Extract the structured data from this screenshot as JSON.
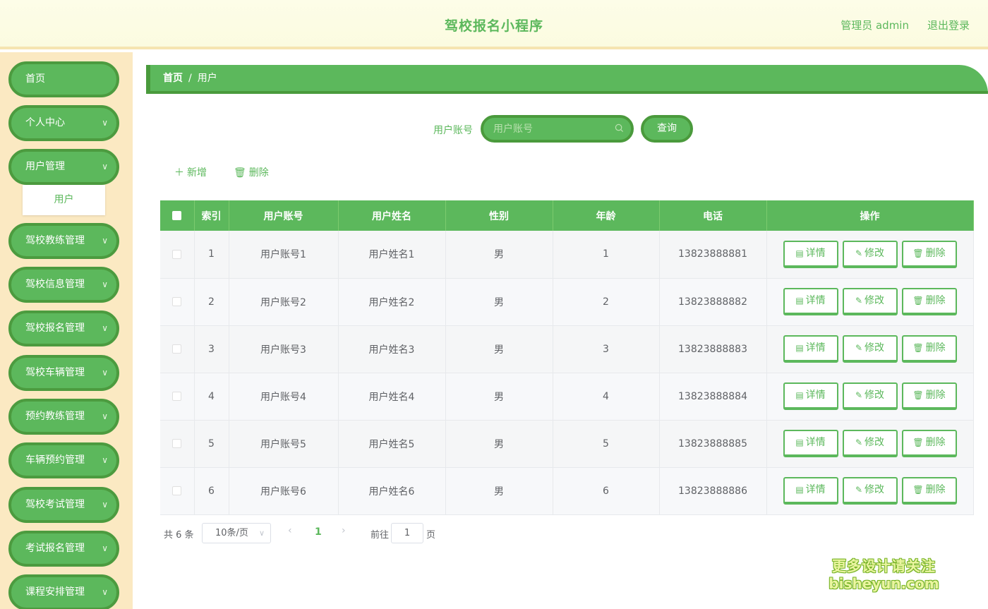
{
  "header": {
    "title": "驾校报名小程序",
    "user": "管理员 admin",
    "logout": "退出登录"
  },
  "sidebar": {
    "items": [
      {
        "label": "首页",
        "has_children": false
      },
      {
        "label": "个人中心",
        "has_children": true
      },
      {
        "label": "用户管理",
        "has_children": true,
        "expanded": true,
        "children": [
          {
            "label": "用户"
          }
        ]
      },
      {
        "label": "驾校教练管理",
        "has_children": true
      },
      {
        "label": "驾校信息管理",
        "has_children": true
      },
      {
        "label": "驾校报名管理",
        "has_children": true
      },
      {
        "label": "驾校车辆管理",
        "has_children": true
      },
      {
        "label": "预约教练管理",
        "has_children": true
      },
      {
        "label": "车辆预约管理",
        "has_children": true
      },
      {
        "label": "驾校考试管理",
        "has_children": true
      },
      {
        "label": "考试报名管理",
        "has_children": true
      },
      {
        "label": "课程安排管理",
        "has_children": true
      }
    ]
  },
  "breadcrumb": {
    "home": "首页",
    "separator": "/",
    "current": "用户"
  },
  "search": {
    "label": "用户账号",
    "placeholder": "用户账号",
    "value": "",
    "button": "查询"
  },
  "actions": {
    "add": "新增",
    "delete": "删除"
  },
  "table": {
    "columns": [
      "索引",
      "用户账号",
      "用户姓名",
      "性别",
      "年龄",
      "电话",
      "操作"
    ],
    "rows": [
      {
        "index": "1",
        "account": "用户账号1",
        "name": "用户姓名1",
        "gender": "男",
        "age": "1",
        "phone": "13823888881"
      },
      {
        "index": "2",
        "account": "用户账号2",
        "name": "用户姓名2",
        "gender": "男",
        "age": "2",
        "phone": "13823888882"
      },
      {
        "index": "3",
        "account": "用户账号3",
        "name": "用户姓名3",
        "gender": "男",
        "age": "3",
        "phone": "13823888883"
      },
      {
        "index": "4",
        "account": "用户账号4",
        "name": "用户姓名4",
        "gender": "男",
        "age": "4",
        "phone": "13823888884"
      },
      {
        "index": "5",
        "account": "用户账号5",
        "name": "用户姓名5",
        "gender": "男",
        "age": "5",
        "phone": "13823888885"
      },
      {
        "index": "6",
        "account": "用户账号6",
        "name": "用户姓名6",
        "gender": "男",
        "age": "6",
        "phone": "13823888886"
      }
    ],
    "row_actions": {
      "detail": "详情",
      "edit": "修改",
      "delete": "删除"
    }
  },
  "pagination": {
    "total": "共 6 条",
    "page_size": "10条/页",
    "current_page": "1",
    "goto_prefix": "前往",
    "goto_value": "1",
    "goto_suffix": "页"
  },
  "watermark": {
    "line1": "更多设计请关注",
    "line2": "bisheyun.com"
  },
  "colors": {
    "primary": "#5cb85c",
    "primary_dark": "#4a9a3c",
    "sidebar_bg": "#fbe9c2",
    "header_bg": "#fdfde8"
  },
  "icons": {
    "search": "search-icon",
    "add": "plus-icon",
    "delete": "trash-icon",
    "detail": "document-icon",
    "edit": "pencil-icon",
    "chevron": "chevron-down-icon"
  }
}
